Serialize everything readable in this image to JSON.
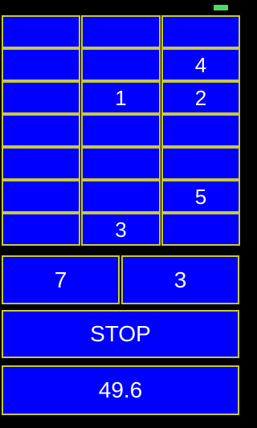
{
  "grid": {
    "rows": [
      [
        "",
        "",
        ""
      ],
      [
        "",
        "",
        "4"
      ],
      [
        "",
        "1",
        "2"
      ],
      [
        "",
        "",
        ""
      ],
      [
        "",
        "",
        ""
      ],
      [
        "",
        "",
        "5"
      ],
      [
        "",
        "3",
        ""
      ]
    ]
  },
  "answers": [
    "7",
    "3"
  ],
  "stop_label": "STOP",
  "timer": "49.6",
  "colors": {
    "background": "#000000",
    "tile": "#0000ff",
    "tile_border": "#c9c93a",
    "text": "#ffffff",
    "battery": "#4cd964"
  }
}
